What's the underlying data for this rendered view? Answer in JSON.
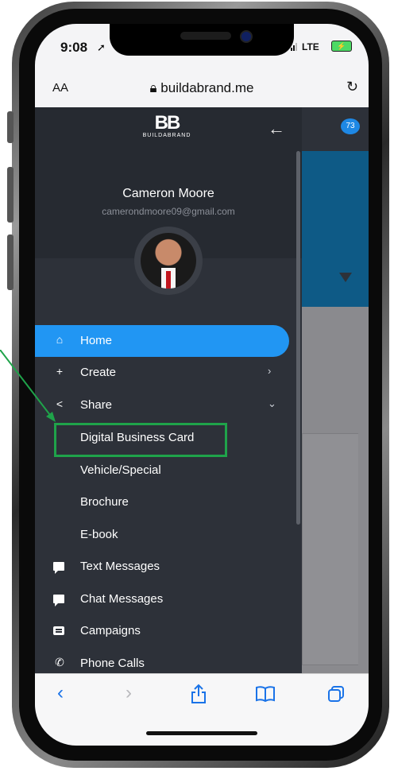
{
  "status_bar": {
    "time": "9:08",
    "network": "LTE"
  },
  "browser": {
    "text_size_label": "AA",
    "url": "buildabrand.me"
  },
  "background_page": {
    "notification_count": "73"
  },
  "drawer": {
    "logo_mark": "BB",
    "logo_text": "BUILDABRAND",
    "user_name": "Cameron Moore",
    "user_email": "camerondmoore09@gmail.com",
    "nav": {
      "home": "Home",
      "create": "Create",
      "share": "Share",
      "share_sub": [
        "Digital Business Card",
        "Vehicle/Special",
        "Brochure",
        "E-book"
      ],
      "text_messages": "Text Messages",
      "chat_messages": "Chat Messages",
      "campaigns": "Campaigns",
      "phone_calls": "Phone Calls"
    }
  },
  "colors": {
    "accent": "#2196f3",
    "drawer_bg": "#2d3139",
    "highlight": "#1fa34a",
    "safari_blue": "#1a73e8"
  }
}
